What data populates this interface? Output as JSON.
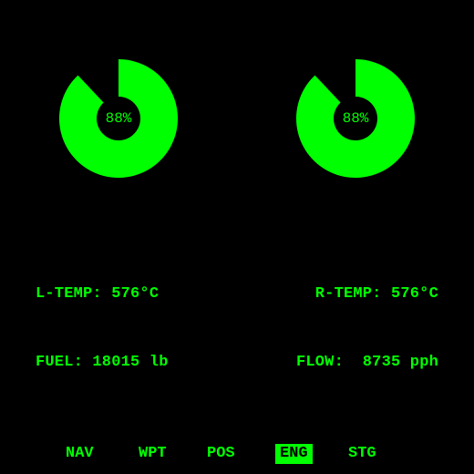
{
  "colors": {
    "accent": "#00ff00",
    "background": "#000000"
  },
  "gauges": [
    {
      "id": "left",
      "percent": 88,
      "label": "88%"
    },
    {
      "id": "right",
      "percent": 88,
      "label": "88%"
    }
  ],
  "readouts": {
    "l_temp": "L-TEMP: 576°C",
    "r_temp": "R-TEMP: 576°C",
    "fuel": "FUEL: 18015 lb",
    "flow": "FLOW:  8735 pph"
  },
  "nav": {
    "items": [
      "NAV",
      "WPT",
      "POS",
      "ENG",
      "STG"
    ],
    "active": "ENG"
  }
}
